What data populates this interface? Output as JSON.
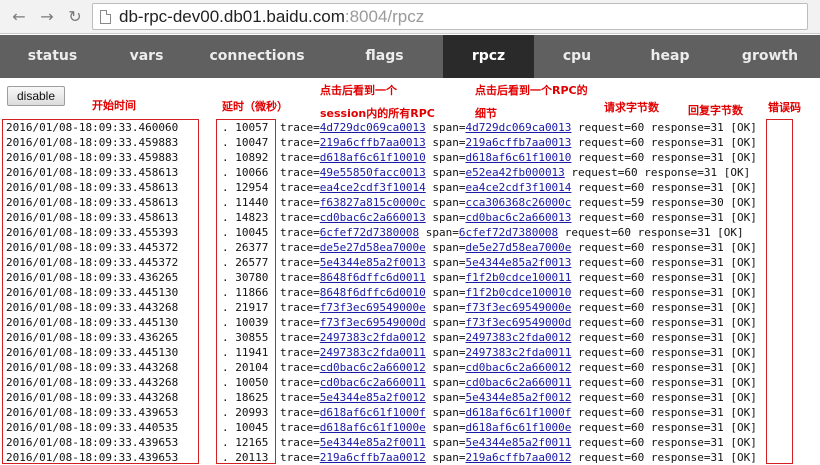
{
  "browser": {
    "url_host": "db-rpc-dev00.db01.baidu.com",
    "url_rest": ":8004/rpcz"
  },
  "nav": {
    "tabs": [
      {
        "label": "status"
      },
      {
        "label": "vars"
      },
      {
        "label": "connections"
      },
      {
        "label": "flags"
      },
      {
        "label": "rpcz"
      },
      {
        "label": "cpu"
      },
      {
        "label": "heap"
      },
      {
        "label": "growth"
      }
    ],
    "active": "rpcz"
  },
  "controls": {
    "disable_label": "disable"
  },
  "annotations": {
    "start_time": "开始时间",
    "latency": "延时（微秒）",
    "trace_line1": "点击后看到一个",
    "trace_line2": "session内的所有RPC",
    "span_line1": "点击后看到一个RPC的",
    "span_line2": "细节",
    "request_bytes": "请求字节数",
    "response_bytes": "回复字节数",
    "error_code": "错误码"
  },
  "rows": [
    {
      "ts": "2016/01/08-18:09:33.460060",
      "lat": ". 10057",
      "trace": "4d729dc069ca0013",
      "span": "4d729dc069ca0013",
      "req": "60",
      "resp": "31",
      "status": "[OK]"
    },
    {
      "ts": "2016/01/08-18:09:33.459883",
      "lat": ". 10047",
      "trace": "219a6cffb7aa0013",
      "span": "219a6cffb7aa0013",
      "req": "60",
      "resp": "31",
      "status": "[OK]"
    },
    {
      "ts": "2016/01/08-18:09:33.459883",
      "lat": ". 10892",
      "trace": "d618af6c61f10010",
      "span": "d618af6c61f10010",
      "req": "60",
      "resp": "31",
      "status": "[OK]"
    },
    {
      "ts": "2016/01/08-18:09:33.458613",
      "lat": ". 10066",
      "trace": "49e55850facc0013",
      "span": "e52ea42fb000013",
      "req": "60",
      "resp": "31",
      "status": "[OK]"
    },
    {
      "ts": "2016/01/08-18:09:33.458613",
      "lat": ". 12954",
      "trace": "ea4ce2cdf3f10014",
      "span": "ea4ce2cdf3f10014",
      "req": "60",
      "resp": "31",
      "status": "[OK]"
    },
    {
      "ts": "2016/01/08-18:09:33.458613",
      "lat": ". 11440",
      "trace": "f63827a815c0000c",
      "span": "cca306368c26000c",
      "req": "59",
      "resp": "30",
      "status": "[OK]"
    },
    {
      "ts": "2016/01/08-18:09:33.458613",
      "lat": ". 14823",
      "trace": "cd0bac6c2a660013",
      "span": "cd0bac6c2a660013",
      "req": "60",
      "resp": "31",
      "status": "[OK]"
    },
    {
      "ts": "2016/01/08-18:09:33.455393",
      "lat": ". 10045",
      "trace": "6cfef72d7380008",
      "span": "6cfef72d7380008",
      "req": "60",
      "resp": "31",
      "status": "[OK]"
    },
    {
      "ts": "2016/01/08-18:09:33.445372",
      "lat": ". 26377",
      "trace": "de5e27d58ea7000e",
      "span": "de5e27d58ea7000e",
      "req": "60",
      "resp": "31",
      "status": "[OK]"
    },
    {
      "ts": "2016/01/08-18:09:33.445372",
      "lat": ". 26577",
      "trace": "5e4344e85a2f0013",
      "span": "5e4344e85a2f0013",
      "req": "60",
      "resp": "31",
      "status": "[OK]"
    },
    {
      "ts": "2016/01/08-18:09:33.436265",
      "lat": ". 30780",
      "trace": "8648f6dffc6d0011",
      "span": "f1f2b0cdce100011",
      "req": "60",
      "resp": "31",
      "status": "[OK]"
    },
    {
      "ts": "2016/01/08-18:09:33.445130",
      "lat": ". 11866",
      "trace": "8648f6dffc6d0010",
      "span": "f1f2b0cdce100010",
      "req": "60",
      "resp": "31",
      "status": "[OK]"
    },
    {
      "ts": "2016/01/08-18:09:33.443268",
      "lat": ". 21917",
      "trace": "f73f3ec69549000e",
      "span": "f73f3ec69549000e",
      "req": "60",
      "resp": "31",
      "status": "[OK]"
    },
    {
      "ts": "2016/01/08-18:09:33.445130",
      "lat": ". 10039",
      "trace": "f73f3ec69549000d",
      "span": "f73f3ec69549000d",
      "req": "60",
      "resp": "31",
      "status": "[OK]"
    },
    {
      "ts": "2016/01/08-18:09:33.436265",
      "lat": ". 30855",
      "trace": "2497383c2fda0012",
      "span": "2497383c2fda0012",
      "req": "60",
      "resp": "31",
      "status": "[OK]"
    },
    {
      "ts": "2016/01/08-18:09:33.445130",
      "lat": ". 11941",
      "trace": "2497383c2fda0011",
      "span": "2497383c2fda0011",
      "req": "60",
      "resp": "31",
      "status": "[OK]"
    },
    {
      "ts": "2016/01/08-18:09:33.443268",
      "lat": ". 20104",
      "trace": "cd0bac6c2a660012",
      "span": "cd0bac6c2a660012",
      "req": "60",
      "resp": "31",
      "status": "[OK]"
    },
    {
      "ts": "2016/01/08-18:09:33.443268",
      "lat": ". 10050",
      "trace": "cd0bac6c2a660011",
      "span": "cd0bac6c2a660011",
      "req": "60",
      "resp": "31",
      "status": "[OK]"
    },
    {
      "ts": "2016/01/08-18:09:33.443268",
      "lat": ". 18625",
      "trace": "5e4344e85a2f0012",
      "span": "5e4344e85a2f0012",
      "req": "60",
      "resp": "31",
      "status": "[OK]"
    },
    {
      "ts": "2016/01/08-18:09:33.439653",
      "lat": ". 20993",
      "trace": "d618af6c61f1000f",
      "span": "d618af6c61f1000f",
      "req": "60",
      "resp": "31",
      "status": "[OK]"
    },
    {
      "ts": "2016/01/08-18:09:33.440535",
      "lat": ". 10045",
      "trace": "d618af6c61f1000e",
      "span": "d618af6c61f1000e",
      "req": "60",
      "resp": "31",
      "status": "[OK]"
    },
    {
      "ts": "2016/01/08-18:09:33.439653",
      "lat": ". 12165",
      "trace": "5e4344e85a2f0011",
      "span": "5e4344e85a2f0011",
      "req": "60",
      "resp": "31",
      "status": "[OK]"
    },
    {
      "ts": "2016/01/08-18:09:33.439653",
      "lat": ". 20113",
      "trace": "219a6cffb7aa0012",
      "span": "219a6cffb7aa0012",
      "req": "60",
      "resp": "31",
      "status": "[OK]"
    }
  ]
}
